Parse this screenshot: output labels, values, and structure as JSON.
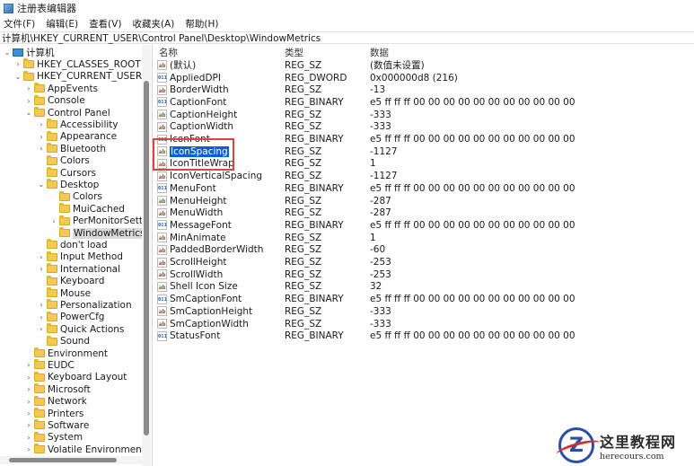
{
  "window": {
    "title": "注册表编辑器"
  },
  "menu": [
    "文件(F)",
    "编辑(E)",
    "查看(V)",
    "收藏夹(A)",
    "帮助(H)"
  ],
  "address": "计算机\\HKEY_CURRENT_USER\\Control Panel\\Desktop\\WindowMetrics",
  "tree": [
    {
      "label": "计算机",
      "level": 0,
      "chev": "down",
      "icon": "computer-icon"
    },
    {
      "label": "HKEY_CLASSES_ROOT",
      "level": 1,
      "chev": "right"
    },
    {
      "label": "HKEY_CURRENT_USER",
      "level": 1,
      "chev": "down"
    },
    {
      "label": "AppEvents",
      "level": 2,
      "chev": "right"
    },
    {
      "label": "Console",
      "level": 2,
      "chev": "right"
    },
    {
      "label": "Control Panel",
      "level": 2,
      "chev": "down"
    },
    {
      "label": "Accessibility",
      "level": 3,
      "chev": "right"
    },
    {
      "label": "Appearance",
      "level": 3,
      "chev": "right"
    },
    {
      "label": "Bluetooth",
      "level": 3,
      "chev": "right"
    },
    {
      "label": "Colors",
      "level": 3,
      "chev": ""
    },
    {
      "label": "Cursors",
      "level": 3,
      "chev": ""
    },
    {
      "label": "Desktop",
      "level": 3,
      "chev": "down"
    },
    {
      "label": "Colors",
      "level": 4,
      "chev": ""
    },
    {
      "label": "MuiCached",
      "level": 4,
      "chev": ""
    },
    {
      "label": "PerMonitorSettin",
      "level": 4,
      "chev": "right"
    },
    {
      "label": "WindowMetrics",
      "level": 4,
      "chev": "",
      "selected": true
    },
    {
      "label": "don't load",
      "level": 3,
      "chev": ""
    },
    {
      "label": "Input Method",
      "level": 3,
      "chev": "right"
    },
    {
      "label": "International",
      "level": 3,
      "chev": "right"
    },
    {
      "label": "Keyboard",
      "level": 3,
      "chev": ""
    },
    {
      "label": "Mouse",
      "level": 3,
      "chev": ""
    },
    {
      "label": "Personalization",
      "level": 3,
      "chev": "right"
    },
    {
      "label": "PowerCfg",
      "level": 3,
      "chev": "right"
    },
    {
      "label": "Quick Actions",
      "level": 3,
      "chev": "right"
    },
    {
      "label": "Sound",
      "level": 3,
      "chev": ""
    },
    {
      "label": "Environment",
      "level": 2,
      "chev": ""
    },
    {
      "label": "EUDC",
      "level": 2,
      "chev": "right"
    },
    {
      "label": "Keyboard Layout",
      "level": 2,
      "chev": "right"
    },
    {
      "label": "Microsoft",
      "level": 2,
      "chev": "right"
    },
    {
      "label": "Network",
      "level": 2,
      "chev": "right"
    },
    {
      "label": "Printers",
      "level": 2,
      "chev": "right"
    },
    {
      "label": "Software",
      "level": 2,
      "chev": "right"
    },
    {
      "label": "System",
      "level": 2,
      "chev": "right"
    },
    {
      "label": "Volatile Environment",
      "level": 2,
      "chev": "right"
    }
  ],
  "columns": {
    "name": "名称",
    "type": "类型",
    "data": "数据"
  },
  "values": [
    {
      "name": "(默认)",
      "type": "REG_SZ",
      "data": "(数值未设置)",
      "icon": "ab"
    },
    {
      "name": "AppliedDPI",
      "type": "REG_DWORD",
      "data": "0x000000d8 (216)",
      "icon": "bin"
    },
    {
      "name": "BorderWidth",
      "type": "REG_SZ",
      "data": "-13",
      "icon": "ab"
    },
    {
      "name": "CaptionFont",
      "type": "REG_BINARY",
      "data": "e5 ff ff ff 00 00 00 00 00 00 00 00 00 00 00 00 9...",
      "icon": "bin"
    },
    {
      "name": "CaptionHeight",
      "type": "REG_SZ",
      "data": "-333",
      "icon": "ab"
    },
    {
      "name": "CaptionWidth",
      "type": "REG_SZ",
      "data": "-333",
      "icon": "ab"
    },
    {
      "name": "IconFont",
      "type": "REG_BINARY",
      "data": "e5 ff ff ff 00 00 00 00 00 00 00 00 00 00 00 00 9...",
      "icon": "bin"
    },
    {
      "name": "IconSpacing",
      "type": "REG_SZ",
      "data": "-1127",
      "icon": "ab",
      "selected": true
    },
    {
      "name": "IconTitleWrap",
      "type": "REG_SZ",
      "data": "1",
      "icon": "ab"
    },
    {
      "name": "IconVerticalSpacing",
      "type": "REG_SZ",
      "data": "-1127",
      "icon": "ab"
    },
    {
      "name": "MenuFont",
      "type": "REG_BINARY",
      "data": "e5 ff ff ff 00 00 00 00 00 00 00 00 00 00 00 00 9...",
      "icon": "bin"
    },
    {
      "name": "MenuHeight",
      "type": "REG_SZ",
      "data": "-287",
      "icon": "ab"
    },
    {
      "name": "MenuWidth",
      "type": "REG_SZ",
      "data": "-287",
      "icon": "ab"
    },
    {
      "name": "MessageFont",
      "type": "REG_BINARY",
      "data": "e5 ff ff ff 00 00 00 00 00 00 00 00 00 00 00 00 9...",
      "icon": "bin"
    },
    {
      "name": "MinAnimate",
      "type": "REG_SZ",
      "data": "1",
      "icon": "ab"
    },
    {
      "name": "PaddedBorderWidth",
      "type": "REG_SZ",
      "data": "-60",
      "icon": "ab"
    },
    {
      "name": "ScrollHeight",
      "type": "REG_SZ",
      "data": "-253",
      "icon": "ab"
    },
    {
      "name": "ScrollWidth",
      "type": "REG_SZ",
      "data": "-253",
      "icon": "ab"
    },
    {
      "name": "Shell Icon Size",
      "type": "REG_SZ",
      "data": "32",
      "icon": "ab"
    },
    {
      "name": "SmCaptionFont",
      "type": "REG_BINARY",
      "data": "e5 ff ff ff 00 00 00 00 00 00 00 00 00 00 00 00 9...",
      "icon": "bin"
    },
    {
      "name": "SmCaptionHeight",
      "type": "REG_SZ",
      "data": "-333",
      "icon": "ab"
    },
    {
      "name": "SmCaptionWidth",
      "type": "REG_SZ",
      "data": "-333",
      "icon": "ab"
    },
    {
      "name": "StatusFont",
      "type": "REG_BINARY",
      "data": "e5 ff ff ff 00 00 00 00 00 00 00 00 00 00 00 00 9...",
      "icon": "bin"
    }
  ],
  "watermark": {
    "logo_letter": "Z",
    "title": "这里教程网",
    "url": "herecours.com"
  },
  "colors": {
    "selection": "#0b5fce",
    "highlight_box": "#d64541",
    "folder": "#f3c956"
  }
}
